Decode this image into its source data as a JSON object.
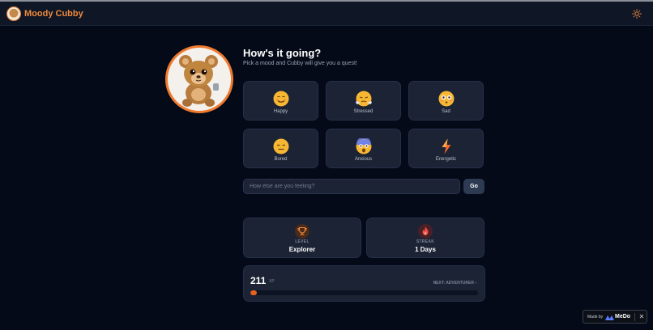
{
  "app": {
    "title": "Moody Cubby"
  },
  "hero": {
    "title": "How's it going?",
    "subtitle": "Pick a mood and Cubby will give you a quest!"
  },
  "moods": [
    {
      "label": "Happy",
      "icon": "smiling-face-icon"
    },
    {
      "label": "Stressed",
      "icon": "steaming-face-icon"
    },
    {
      "label": "Sad",
      "icon": "flushed-face-icon"
    },
    {
      "label": "Bored",
      "icon": "expressionless-face-icon"
    },
    {
      "label": "Anxious",
      "icon": "screaming-face-icon"
    },
    {
      "label": "Energetic",
      "icon": "lightning-bolt-icon"
    }
  ],
  "custom_mood": {
    "placeholder": "How else are you feeling?",
    "value": "",
    "button_label": "Go"
  },
  "stats": {
    "level": {
      "caption": "LEVEL",
      "value": "Explorer",
      "icon": "trophy-icon"
    },
    "streak": {
      "caption": "STREAK",
      "value": "1 Days",
      "icon": "flame-icon"
    }
  },
  "xp": {
    "value": "211",
    "unit": "XP",
    "next_label": "NEXT: ADVENTURER ›",
    "progress_fraction": 0.03
  },
  "badge": {
    "made_by": "Made by",
    "brand": "MeDo",
    "close": "✕"
  },
  "colors": {
    "accent": "#ef7a2e",
    "background": "#050a18",
    "card": "#1b2334",
    "header": "#0f1626"
  }
}
